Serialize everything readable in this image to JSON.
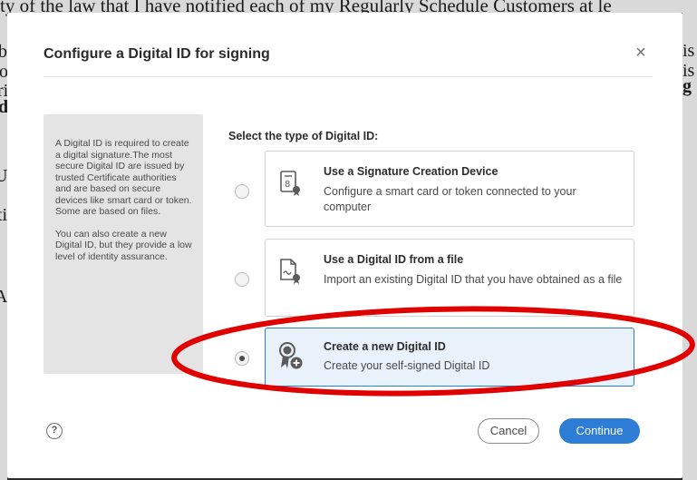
{
  "background_document": {
    "top_line": "ty of the law that I have notified each of my Regularly Schedule Customers at le",
    "edge_glyphs_left": [
      "bl",
      "o",
      "ri",
      "d",
      "U",
      "ti",
      "A"
    ],
    "edge_glyphs_right": [
      "is",
      "is",
      "y",
      "g"
    ]
  },
  "dialog": {
    "title": "Configure a Digital ID for signing",
    "close_symbol": "×",
    "info": {
      "paragraph1": "A Digital ID is required to create a digital signature.The most secure Digital ID are issued by trusted Certificate authorities and are based on secure devices like smart card or token. Some are based on files.",
      "paragraph2": "You can also create a new Digital ID, but they provide a low level of identity assurance."
    },
    "select_label": "Select the type of Digital ID:",
    "options": [
      {
        "title": "Use a Signature Creation Device",
        "description": "Configure a smart card or token connected to your computer",
        "icon": "smartcard-icon",
        "selected": false
      },
      {
        "title": "Use a Digital ID from a file",
        "description": "Import an existing Digital ID that you have obtained as a file",
        "icon": "certificate-file-icon",
        "selected": false
      },
      {
        "title": "Create a new Digital ID",
        "description": "Create your self-signed Digital ID",
        "icon": "new-digital-id-icon",
        "selected": true
      }
    ],
    "help_symbol": "?",
    "cancel_label": "Cancel",
    "continue_label": "Continue"
  },
  "colors": {
    "accent": "#2d7cd6",
    "annotation": "#e00000",
    "selected_bg": "#e9f1fb"
  }
}
